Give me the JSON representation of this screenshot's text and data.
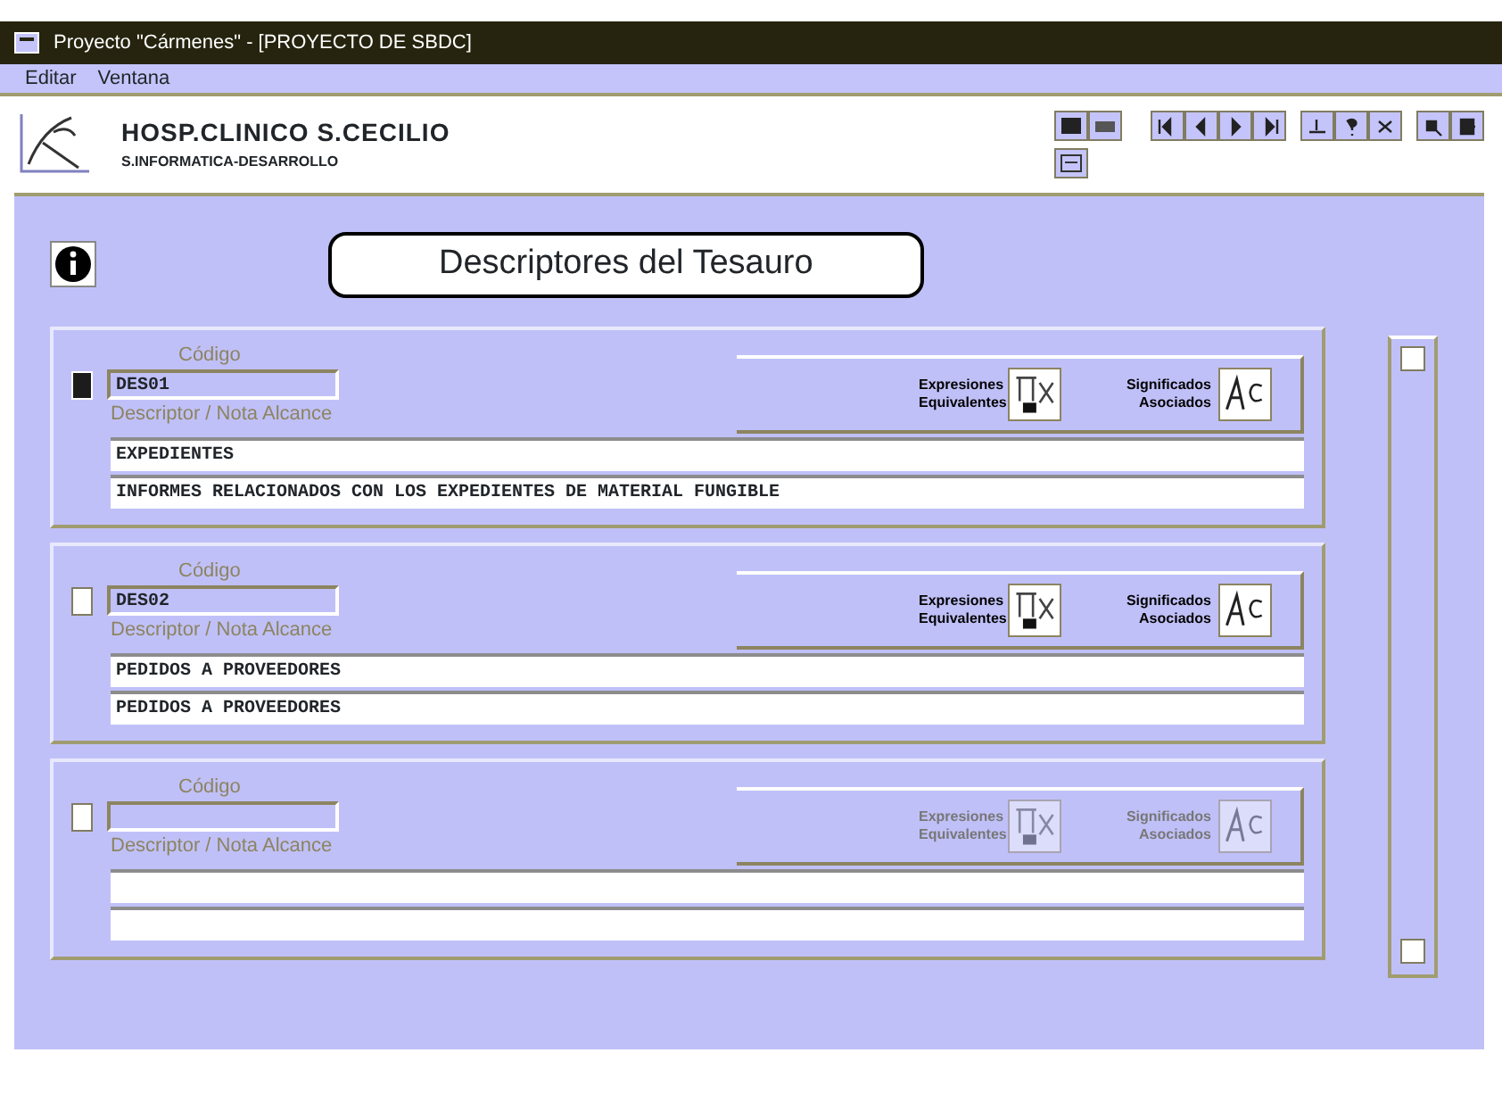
{
  "window": {
    "title": "Proyecto \"Cármenes\" - [PROYECTO DE SBDC]"
  },
  "menu": [
    "Editar",
    "Ventana"
  ],
  "header": {
    "organization": "HOSP.CLINICO S.CECILIO",
    "department": "S.INFORMATICA-DESARROLLO"
  },
  "form": {
    "title": "Descriptores del Tesauro",
    "records": [
      {
        "selected": true,
        "code_label": "Código",
        "code": "DES01",
        "descriptor_label": "Descriptor / Nota Alcance",
        "descriptor": "EXPEDIENTES",
        "scope_note": "INFORMES RELACIONADOS CON LOS EXPEDIENTES DE MATERIAL FUNGIBLE",
        "equivalents_button": "Expresiones Equivalentes",
        "associated_button": "Significados Asociados",
        "disabled": false
      },
      {
        "selected": false,
        "code_label": "Código",
        "code": "DES02",
        "descriptor_label": "Descriptor / Nota Alcance",
        "descriptor": "PEDIDOS A PROVEEDORES",
        "scope_note": "PEDIDOS A PROVEEDORES",
        "equivalents_button": "Expresiones Equivalentes",
        "associated_button": "Significados Asociados",
        "disabled": false
      },
      {
        "selected": false,
        "code_label": "Código",
        "descriptor_label": "Descriptor / Nota Alcance",
        "equivalents_button": "Expresiones Equivalentes",
        "associated_button": "Significados Asociados",
        "disabled": true
      }
    ]
  }
}
